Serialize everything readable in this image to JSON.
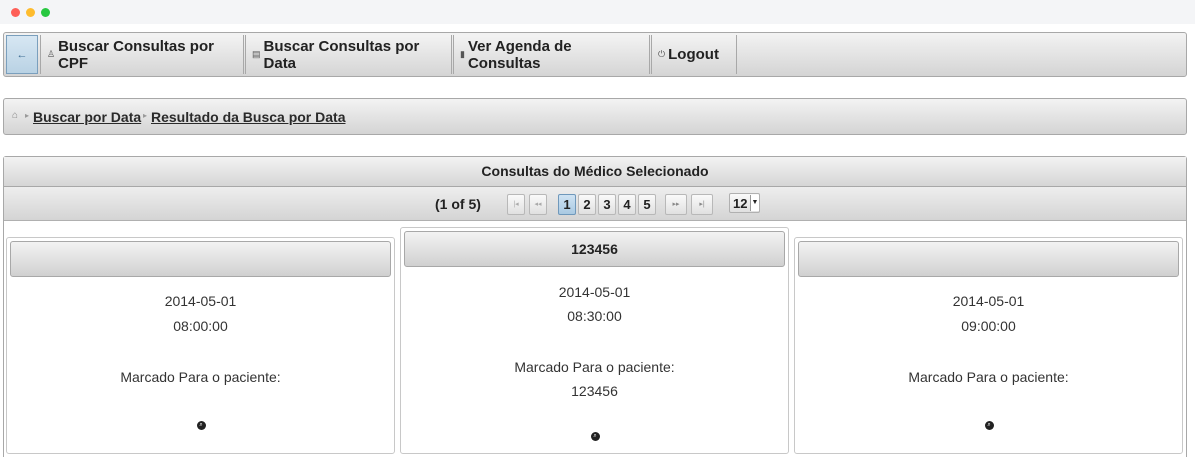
{
  "menu": {
    "back_icon": "←",
    "items": [
      {
        "icon": "♙",
        "label": "Buscar Consultas por CPF"
      },
      {
        "icon": "▤",
        "label": "Buscar Consultas por Data"
      },
      {
        "icon": "▮",
        "label": "Ver Agenda de Consultas"
      },
      {
        "icon": "⏻",
        "label": "Logout"
      }
    ]
  },
  "breadcrumb": {
    "home_icon": "⌂",
    "items": [
      "Buscar por Data",
      "Resultado da Busca por Data"
    ]
  },
  "panel": {
    "title": "Consultas do Médico Selecionado",
    "report": "(1 of 5)",
    "pages": [
      "1",
      "2",
      "3",
      "4",
      "5"
    ],
    "active_page": "1",
    "first_icon": "|◂",
    "prev_icon": "◂◂",
    "next_icon": "▸▸",
    "last_icon": "▸|",
    "rows_per_page": "12"
  },
  "cards": [
    {
      "header": "",
      "date": "2014-05-01",
      "time": "08:00:00",
      "label": "Marcado Para o paciente:",
      "patient": "",
      "icon": "search-icon"
    },
    {
      "header": "123456",
      "date": "2014-05-01",
      "time": "08:30:00",
      "label": "Marcado Para o paciente:",
      "patient": "123456",
      "icon": "search-icon"
    },
    {
      "header": "",
      "date": "2014-05-01",
      "time": "09:00:00",
      "label": "Marcado Para o paciente:",
      "patient": "",
      "icon": "search-icon"
    }
  ]
}
